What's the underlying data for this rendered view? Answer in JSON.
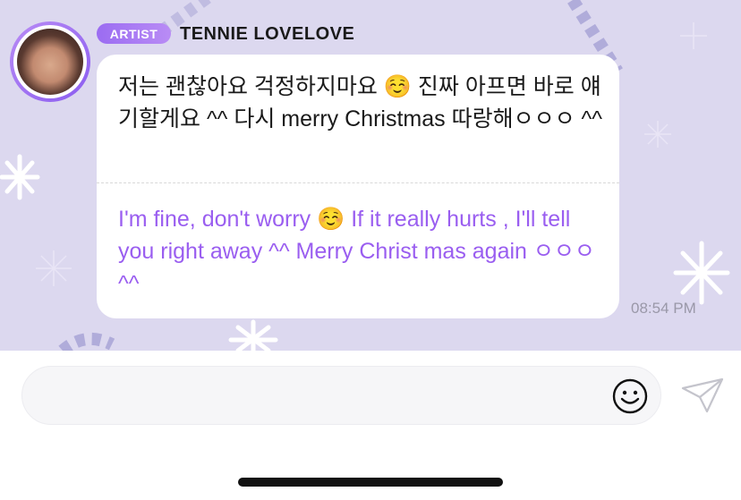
{
  "sender": {
    "badge": "ARTIST",
    "name": "TENNIE LOVELOVE",
    "avatar_icon": "profile-photo"
  },
  "message": {
    "original": "저는 괜찮아요 걱정하지마요 ☺️ 진짜 아프면 바로 얘기할게요 ^^ 다시 merry Christmas 따랑해ㅇㅇㅇ ^^",
    "translated": "I'm fine, don't worry ☺️ If it really hurts , I'll tell you right away ^^ Merry Christ mas again ㅇㅇㅇ ^^",
    "time": "08:54 PM"
  },
  "composer": {
    "input_value": "",
    "emoji_icon": "smiley-icon",
    "send_icon": "paper-plane-icon"
  },
  "colors": {
    "chat_background": "#dcd8ef",
    "accent": "#9a5ef0",
    "badge_gradient_start": "#9b6cf2",
    "badge_gradient_end": "#b98cf5"
  }
}
